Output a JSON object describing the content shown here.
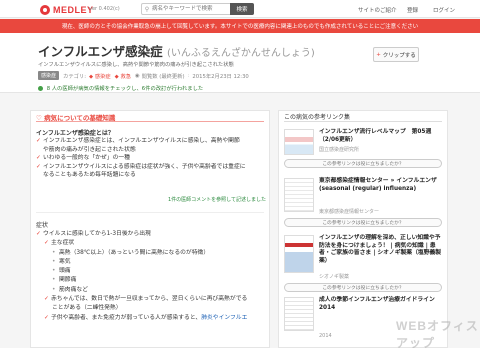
{
  "header": {
    "logo_text": "MEDLEY",
    "version": "ver 0.402(c)",
    "search_placeholder": "病名やキーワードで検索",
    "search_button": "検索",
    "nav": [
      "サイトのご紹介",
      "登録",
      "ログイン"
    ]
  },
  "alert": "現在、医師の方とその協会作業取急の崩上して回覧しています。本サイトでの医療内容に関連上のものでも作成されていることにご注意ください",
  "page": {
    "title": "インフルエンザ感染症",
    "reading": "(いんふるえんざかんせんしょう)",
    "clip_button": "クリップする",
    "subtitle": "インフルエンザウイルスに感染し、高熱や関節や筋肉の痛みが引き起こされた状態",
    "tag": "感染症",
    "meta_category_label": "カテゴリ:",
    "categories": [
      "感染症",
      "救急"
    ],
    "meta_views": "閲覧数 (最終更新)",
    "meta_date": "2015年2月23日 12:30",
    "good_info": "8 人の医師が病気の情報をチェックし、6件の改訂が行われました"
  },
  "main": {
    "section_title": "病気についての基礎知識",
    "question": "インフルエンザ感染症とは？",
    "bullets": [
      {
        "text": "インフルエンザ感染症とは、インフルエンザウイルスに感染し、高熱や関節",
        "cont": "や筋肉の痛みが引き起こされた状態"
      },
      {
        "text": "いわゆる一般的な「かぜ」の一種",
        "cont": ""
      },
      {
        "text": "インフルエンザウイルスによる感染症は症状が強く、子供や高齢者では重症に",
        "cont": "なることもあるため毎年話題になる"
      }
    ],
    "comment_link": "1件の医師コメントを参照して記述しました",
    "symptom_title": "症状",
    "symptoms": {
      "line1": "ウイルスに感染してから1-3日後から出現",
      "main_label": "主な症状",
      "items": [
        "高熱（38℃以上）（あっという間に高熱になるのが特徴）",
        "寒気",
        "頭痛",
        "関節痛",
        "筋肉痛など"
      ],
      "child_line": "赤ちゃんでは、数日で熱が一旦収まってから、翌日くらいに再び高熱がでる",
      "child_cont": "ことがある（二峰性発熱）",
      "elder_line_a": "子供や高齢者、また免疫力が弱っている人が感染すると、",
      "elder_line_link": "肺炎やインフルエ"
    }
  },
  "side": {
    "title": "この病気の参考リンク集",
    "links": [
      {
        "title": "インフルエンザ流行レベルマップ　第05週（2/06更新）",
        "source": "国立感染症研究所",
        "pill": "この参考リンクは役に立ちましたか？"
      },
      {
        "title": "東京都感染症情報センター » インフルエンザ　(seasonal (regular) influenza)",
        "source": "東京都感染症情報センター",
        "pill": "この参考リンクは役に立ちましたか？"
      },
      {
        "title": "インフルエンザの理解を深め、正しい知識や予防法を身につけましょう！ | 病気の知識 | 患者・ご家族の皆さま | シオノギ製薬（塩野義製薬）",
        "source": "シオノギ製薬",
        "pill": "この参考リンクは役に立ちましたか？"
      },
      {
        "title": "成人の季節インフルエンザ治療ガイドライン2014",
        "source": "2014",
        "pill": ""
      }
    ]
  },
  "watermark": "WEBオフィスアップ",
  "colors": {
    "accent": "#e9483e",
    "brand": "#e5383b",
    "good": "#43a047"
  }
}
